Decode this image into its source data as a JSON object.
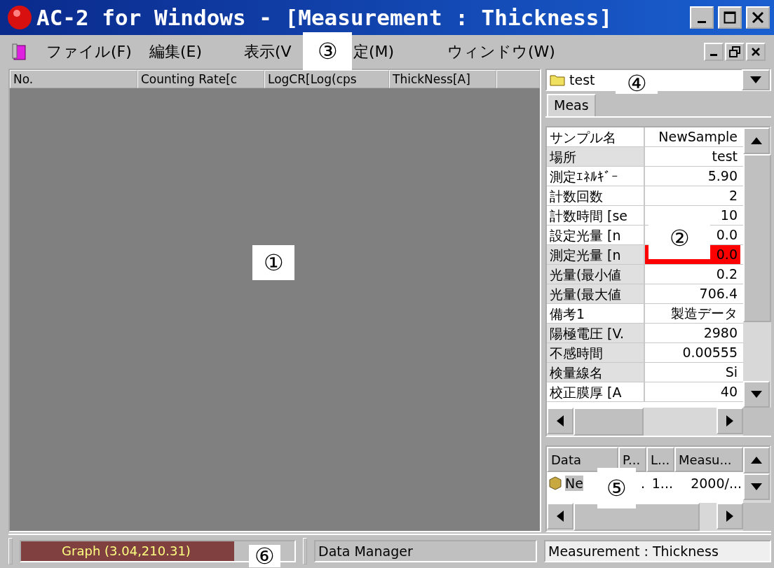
{
  "window": {
    "title": "AC-2 for Windows - [Measurement : Thickness]"
  },
  "menu": {
    "items": [
      "ファイル(F)",
      "編集(E)",
      "表示(V",
      "定(M)",
      "ウィンドウ(W)"
    ]
  },
  "table": {
    "columns": [
      "No.",
      "Counting Rate[c",
      "LogCR[Log(cps",
      "ThickNess[A]"
    ]
  },
  "folder_combo": {
    "value": "test"
  },
  "tabs": [
    {
      "label": "Meas",
      "selected": true
    }
  ],
  "properties": [
    {
      "name": "サンプル名",
      "value": "NewSample",
      "shaded": false,
      "alert": false
    },
    {
      "name": "場所",
      "value": "test",
      "shaded": true,
      "alert": false
    },
    {
      "name": "測定ｴﾈﾙｷﾞｰ",
      "value": "5.90",
      "shaded": false,
      "alert": false
    },
    {
      "name": "計数回数",
      "value": "2",
      "shaded": false,
      "alert": false
    },
    {
      "name": "計数時間 [se",
      "value": "10",
      "shaded": false,
      "alert": false
    },
    {
      "name": "設定光量 [n",
      "value": "0.0",
      "shaded": false,
      "alert": false
    },
    {
      "name": "測定光量 [n",
      "value": "0.0",
      "shaded": true,
      "alert": true
    },
    {
      "name": "光量(最小値",
      "value": "0.2",
      "shaded": true,
      "alert": false
    },
    {
      "name": "光量(最大値",
      "value": "706.4",
      "shaded": true,
      "alert": false
    },
    {
      "name": "備考1",
      "value": "製造データ",
      "shaded": false,
      "alert": false
    },
    {
      "name": "陽極電圧 [V.",
      "value": "2980",
      "shaded": true,
      "alert": false
    },
    {
      "name": "不感時間",
      "value": "0.00555",
      "shaded": true,
      "alert": false
    },
    {
      "name": "検量線名",
      "value": "Si",
      "shaded": true,
      "alert": false
    },
    {
      "name": "校正膜厚 [A",
      "value": "40",
      "shaded": false,
      "alert": false
    }
  ],
  "data_list": {
    "columns": [
      "Data",
      "P...",
      "L...",
      "Measu..."
    ],
    "rows": [
      {
        "cells": [
          "Ne",
          ".",
          "1...",
          "2000/..."
        ],
        "selected": true
      }
    ]
  },
  "status_bar": {
    "graph": {
      "text": "Graph (3.04,210.31)",
      "level": 0.78
    },
    "panels": [
      "Data Manager",
      "Measurement : Thickness"
    ]
  },
  "callouts": [
    "①",
    "②",
    "③",
    "④",
    "⑤",
    "⑥"
  ]
}
